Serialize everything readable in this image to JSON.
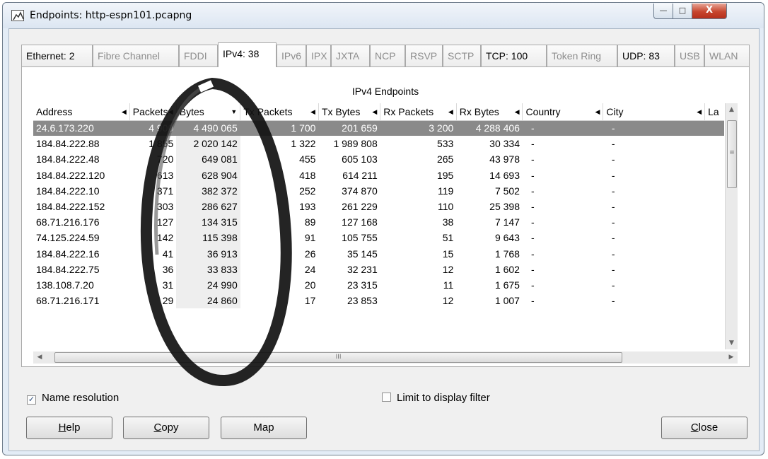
{
  "window": {
    "title": "Endpoints: http-espn101.pcapng",
    "min_glyph": "—",
    "max_glyph": "□",
    "close_glyph": "X"
  },
  "tabs": [
    {
      "label": "Ethernet: 2",
      "bold": true
    },
    {
      "label": "Fibre Channel",
      "bold": false
    },
    {
      "label": "FDDI",
      "bold": false
    },
    {
      "label": "IPv4: 38",
      "bold": true,
      "active": true
    },
    {
      "label": "IPv6",
      "bold": false
    },
    {
      "label": "IPX",
      "bold": false
    },
    {
      "label": "JXTA",
      "bold": false
    },
    {
      "label": "NCP",
      "bold": false
    },
    {
      "label": "RSVP",
      "bold": false
    },
    {
      "label": "SCTP",
      "bold": false
    },
    {
      "label": "TCP: 100",
      "bold": true
    },
    {
      "label": "Token Ring",
      "bold": false
    },
    {
      "label": "UDP: 83",
      "bold": true
    },
    {
      "label": "USB",
      "bold": false
    },
    {
      "label": "WLAN",
      "bold": false
    }
  ],
  "table": {
    "title": "IPv4 Endpoints",
    "columns": [
      {
        "label": "Address",
        "arrow": "◀"
      },
      {
        "label": "Packets",
        "arrow": "◀"
      },
      {
        "label": "Bytes",
        "arrow": "▼"
      },
      {
        "label": "Tx Packets",
        "arrow": "◀"
      },
      {
        "label": "Tx Bytes",
        "arrow": "◀"
      },
      {
        "label": "Rx Packets",
        "arrow": "◀"
      },
      {
        "label": "Rx Bytes",
        "arrow": "◀"
      },
      {
        "label": "Country",
        "arrow": "◀"
      },
      {
        "label": "City",
        "arrow": "◀"
      },
      {
        "label": "La",
        "arrow": ""
      }
    ],
    "selected_row": 0,
    "rows": [
      [
        "24.6.173.220",
        "4 900",
        "4 490 065",
        "1 700",
        "201 659",
        "3 200",
        "4 288 406",
        "-",
        "-"
      ],
      [
        "184.84.222.88",
        "1 855",
        "2 020 142",
        "1 322",
        "1 989 808",
        "533",
        "30 334",
        "-",
        "-"
      ],
      [
        "184.84.222.48",
        "720",
        "649 081",
        "455",
        "605 103",
        "265",
        "43 978",
        "-",
        "-"
      ],
      [
        "184.84.222.120",
        "613",
        "628 904",
        "418",
        "614 211",
        "195",
        "14 693",
        "-",
        "-"
      ],
      [
        "184.84.222.10",
        "371",
        "382 372",
        "252",
        "374 870",
        "119",
        "7 502",
        "-",
        "-"
      ],
      [
        "184.84.222.152",
        "303",
        "286 627",
        "193",
        "261 229",
        "110",
        "25 398",
        "-",
        "-"
      ],
      [
        "68.71.216.176",
        "127",
        "134 315",
        "89",
        "127 168",
        "38",
        "7 147",
        "-",
        "-"
      ],
      [
        "74.125.224.59",
        "142",
        "115 398",
        "91",
        "105 755",
        "51",
        "9 643",
        "-",
        "-"
      ],
      [
        "184.84.222.16",
        "41",
        "36 913",
        "26",
        "35 145",
        "15",
        "1 768",
        "-",
        "-"
      ],
      [
        "184.84.222.75",
        "36",
        "33 833",
        "24",
        "32 231",
        "12",
        "1 602",
        "-",
        "-"
      ],
      [
        "138.108.7.20",
        "31",
        "24 990",
        "20",
        "23 315",
        "11",
        "1 675",
        "-",
        "-"
      ],
      [
        "68.71.216.171",
        "29",
        "24 860",
        "17",
        "23 853",
        "12",
        "1 007",
        "-",
        "-"
      ]
    ]
  },
  "scrollbars": {
    "vertical_up": "▲",
    "vertical_down": "▼",
    "vertical_grip": "≡",
    "horizontal_left": "◀",
    "horizontal_right": "▶",
    "horizontal_grip": "III"
  },
  "options": {
    "name_resolution": {
      "label": "Name resolution",
      "checked": true
    },
    "limit_filter": {
      "label": "Limit to display filter",
      "checked": false
    }
  },
  "buttons": {
    "help": {
      "label": "Help",
      "mnemonic": "H"
    },
    "copy": {
      "label": "Copy",
      "mnemonic": "C"
    },
    "map": {
      "label": "Map"
    },
    "close": {
      "label": "Close",
      "mnemonic": "C"
    }
  },
  "colors": {
    "selected_row": "#8a8a8a",
    "sorted_column": "#eeeeee",
    "annotation_ring": "#1e1e1e"
  }
}
